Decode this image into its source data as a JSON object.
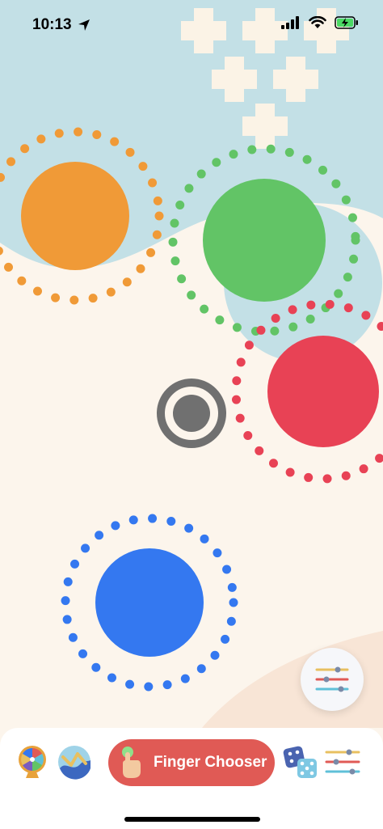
{
  "status": {
    "time": "10:13",
    "icons": [
      "location-arrow-icon",
      "signal-bars-icon",
      "wifi-icon",
      "battery-charging-icon"
    ]
  },
  "game": {
    "touch_circles": [
      {
        "color_name": "orange",
        "color": "#f09a37"
      },
      {
        "color_name": "green",
        "color": "#62c466"
      },
      {
        "color_name": "red",
        "color": "#e84255"
      },
      {
        "color_name": "blue",
        "color": "#3478f0"
      }
    ],
    "center_indicator": {
      "icon": "target-icon",
      "color": "#707070"
    },
    "colors": {
      "background": "#fcf5ec",
      "blob": "#c3e0e6",
      "plus": "#fbf3e6"
    }
  },
  "toolbar": {
    "settings_icon": "sliders-icon",
    "tabs": [
      {
        "id": "wheel",
        "icon": "spin-wheel-icon"
      },
      {
        "id": "path",
        "icon": "path-game-icon"
      },
      {
        "id": "finger",
        "label": "Finger Chooser",
        "icon": "finger-tap-icon",
        "selected": true,
        "color": "#e05a55"
      },
      {
        "id": "dice",
        "icon": "dice-icon"
      },
      {
        "id": "settings",
        "icon": "sliders-icon"
      }
    ]
  }
}
